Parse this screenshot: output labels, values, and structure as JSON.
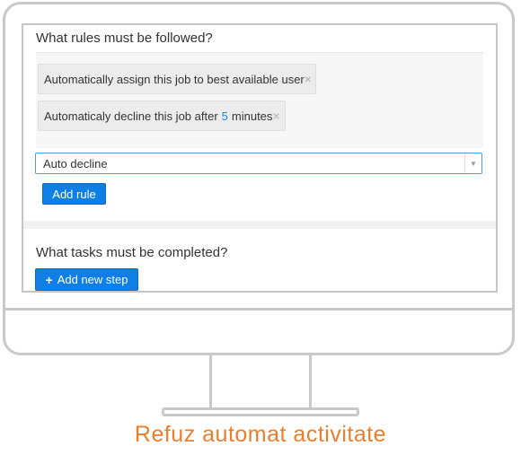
{
  "rules_section": {
    "heading": "What rules must be followed?",
    "rule_1": {
      "text": "Automatically assign this job to best available user",
      "remove": "×"
    },
    "rule_2": {
      "text_before": "Automaticaly decline this job after",
      "minutes_value": "5",
      "text_after": "minutes",
      "remove": "×"
    },
    "rule_select": {
      "selected": "Auto decline",
      "arrow": "▼"
    },
    "add_rule_label": "Add rule"
  },
  "tasks_section": {
    "heading": "What tasks must be completed?",
    "add_step_icon": "+",
    "add_step_label": "Add new step"
  },
  "caption": "Refuz automat activitate",
  "colors": {
    "accent": "#0f7fe6",
    "caption": "#e87f2e",
    "number_highlight": "#1a80e6"
  },
  "icons": {
    "remove": "close-icon",
    "dropdown": "chevron-down-icon",
    "add": "plus-icon"
  }
}
